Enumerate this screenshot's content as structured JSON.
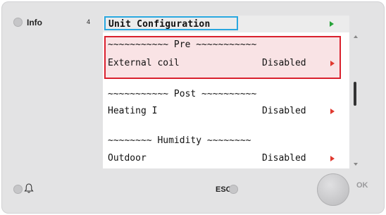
{
  "info_label": "Info",
  "page_number": "4",
  "screen": {
    "title": "Unit Configuration",
    "sections": [
      {
        "header": "~~~~~~~~~~~ Pre ~~~~~~~~~~~",
        "item": "External coil",
        "value": "Disabled",
        "selected": true
      },
      {
        "header": "~~~~~~~~~~~ Post ~~~~~~~~~~",
        "item": "Heating I",
        "value": "Disabled",
        "selected": false
      },
      {
        "header": "~~~~~~~~ Humidity ~~~~~~~~",
        "item": "Outdoor",
        "value": "Disabled",
        "selected": false
      }
    ]
  },
  "esc_label": "ESC",
  "ok_label": "OK",
  "icons": {
    "title_arrow": "green-triangle-right-icon",
    "item_arrow": "red-triangle-right-icon",
    "alarm": "bell-icon"
  },
  "colors": {
    "title_highlight": "#29a7df",
    "selection_border": "#d9212e",
    "selection_fill": "#f9e3e5",
    "arrow_green": "#27a33a",
    "arrow_red": "#e0392f"
  }
}
